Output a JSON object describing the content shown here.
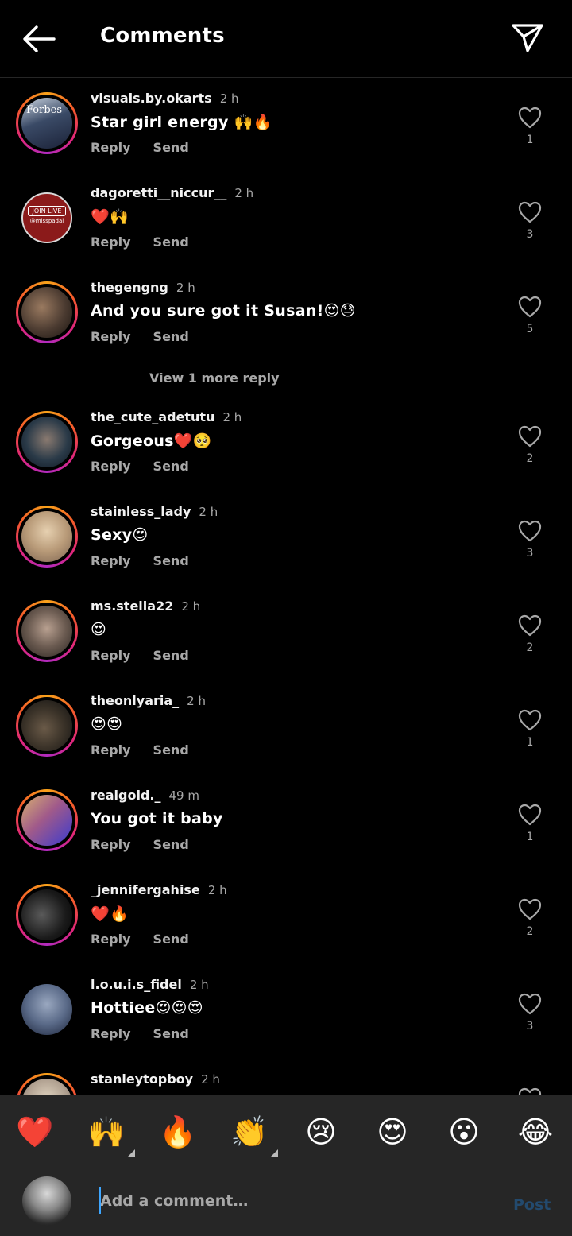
{
  "header": {
    "title": "Comments"
  },
  "comments": [
    {
      "username": "visuals.by.okarts",
      "time": "2 h",
      "text": "Star girl energy 🙌🔥",
      "likes": "1",
      "story": true,
      "avatar_color": "#3a4a66"
    },
    {
      "username": "dagoretti__niccur__",
      "time": "2 h",
      "text": "❤️🙌",
      "likes": "3",
      "story": false,
      "avatar_color": "#8b1a1a",
      "avatar_text": "JOIN LIVE",
      "avatar_subtext": "@misspadal"
    },
    {
      "username": "thegengng",
      "time": "2 h",
      "text": "And you sure got it Susan!😍😓",
      "likes": "5",
      "story": true,
      "avatar_color": "#4a3a30"
    },
    {
      "username": "the_cute_adetutu",
      "time": "2 h",
      "text": "Gorgeous❤️🥺",
      "likes": "2",
      "story": true,
      "avatar_color": "#2a3a48"
    },
    {
      "username": "stainless_lady",
      "time": "2 h",
      "text": "Sexy😍",
      "likes": "3",
      "story": true,
      "avatar_color": "#b89a78"
    },
    {
      "username": "ms.stella22",
      "time": "2 h",
      "text": "😍",
      "likes": "2",
      "story": true,
      "avatar_color": "#6a5a50"
    },
    {
      "username": "theonlyaria_",
      "time": "2 h",
      "text": "😍😍",
      "likes": "1",
      "story": true,
      "avatar_color": "#3a3228"
    },
    {
      "username": "realgold._",
      "time": "49 m",
      "text": "You got it baby",
      "likes": "1",
      "story": true,
      "avatar_color": "#6a4aa0"
    },
    {
      "username": "_jennifergahise",
      "time": "2 h",
      "text": "❤️🔥",
      "likes": "2",
      "story": true,
      "avatar_color": "#1a1a1a"
    },
    {
      "username": "l.o.u.i.s_fidel",
      "time": "2 h",
      "text": "Hottiee😍😍😍",
      "likes": "3",
      "story": false,
      "avatar_color": "#5a6a88"
    },
    {
      "username": "stanleytopboy",
      "time": "2 h",
      "text": "",
      "likes": "",
      "story": true,
      "avatar_color": "#b0a090"
    }
  ],
  "actions": {
    "reply_label": "Reply",
    "send_label": "Send"
  },
  "view_more": {
    "label": "View 1 more reply"
  },
  "emoji_bar": [
    "❤️",
    "🙌",
    "🔥",
    "👏",
    "😢",
    "😍",
    "😮",
    "😂"
  ],
  "composer": {
    "placeholder": "Add a comment…",
    "post_label": "Post"
  },
  "colors": {
    "background": "#000000",
    "bar": "#262626",
    "muted_text": "#a8a8a8",
    "post_disabled": "#234a6e",
    "caret": "#3ea6ff"
  }
}
